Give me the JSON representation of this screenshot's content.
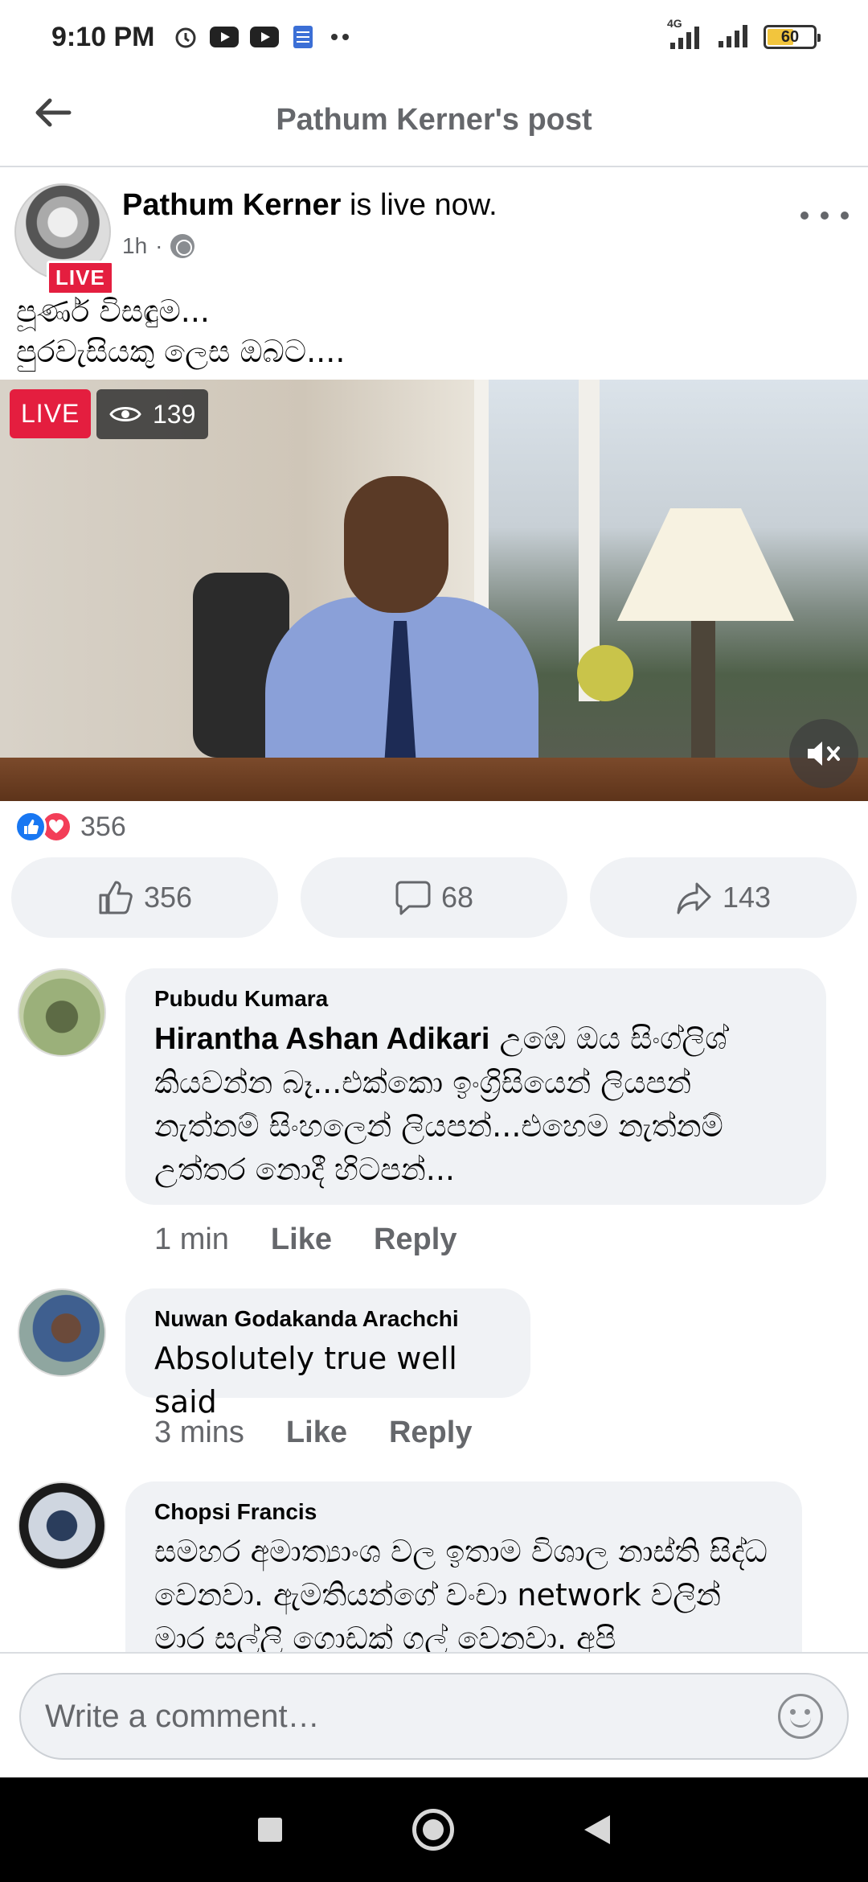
{
  "status_bar": {
    "time": "9:10 PM",
    "network": "4G",
    "battery": "60",
    "battery_level": 0.6
  },
  "header": {
    "title": "Pathum Kerner's post"
  },
  "post": {
    "author": "Pathum Kerner",
    "status": " is live now.",
    "time": "1h",
    "avatar_badge": "LIVE",
    "text_line1": "පූර්ණ විසඳුම...",
    "text_line2": "පුරවැසියකු ලෙස ඔබට...."
  },
  "video": {
    "live_label": "LIVE",
    "viewers": "139"
  },
  "reactions": {
    "count": "356"
  },
  "actions": {
    "like_count": "356",
    "comment_count": "68",
    "share_count": "143"
  },
  "comments": [
    {
      "author": "Pubudu Kumara",
      "mention": "Hirantha Ashan Adikari",
      "text": " උඹෙ ඔය සිංග්ලිශ් කියවන්න බෑ...එක්කො ඉංග්‍රිසියෙන් ලියපන් නැත්නම් සිංහලෙන් ලියපන්...එහෙම නැත්නම් උත්තර නොදී හිටපන්...",
      "time": "1 min",
      "like": "Like",
      "reply": "Reply"
    },
    {
      "author": "Nuwan Godakanda Arachchi",
      "text": "Absolutely true well said",
      "time": "3 mins",
      "like": "Like",
      "reply": "Reply"
    },
    {
      "author": "Chopsi Francis",
      "text": "සමහර අමාත්‍යාංශ වල ඉතාම විශාල නාස්ති සිද්ධ වෙනවා. ඇමතියන්ගේ වංචා network වලින් මාර සල්ලි ගොඩක් ගල් වෙනවා. අපි"
    }
  ],
  "composer": {
    "placeholder": "Write a comment…"
  },
  "colors": {
    "live_red": "#e41e3f",
    "like_blue": "#1877f2",
    "love_red": "#f33e58",
    "bubble_grey": "#f0f2f5",
    "meta_grey": "#65676b"
  }
}
